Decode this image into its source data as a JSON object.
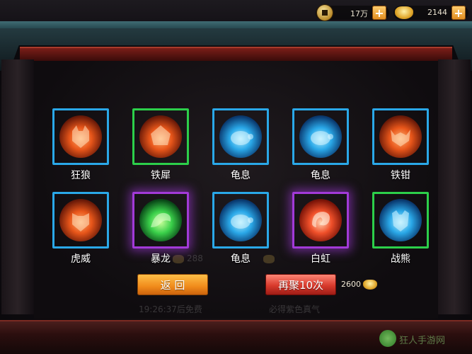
{
  "resources": {
    "coins": {
      "icon": "copper-coin-icon",
      "value": "17万"
    },
    "ingots": {
      "icon": "gold-ingot-icon",
      "value": "2144"
    }
  },
  "grid": [
    {
      "label": "狂狼",
      "rarity": "blue",
      "element": "fire",
      "icon": "wolf-icon"
    },
    {
      "label": "铁犀",
      "rarity": "green",
      "element": "fire",
      "icon": "rhino-icon"
    },
    {
      "label": "龟息",
      "rarity": "blue",
      "element": "water",
      "icon": "turtle-icon"
    },
    {
      "label": "龟息",
      "rarity": "blue",
      "element": "water",
      "icon": "turtle-icon"
    },
    {
      "label": "铁钳",
      "rarity": "blue",
      "element": "fire",
      "icon": "crab-icon"
    },
    {
      "label": "虎威",
      "rarity": "blue",
      "element": "fire",
      "icon": "tiger-icon"
    },
    {
      "label": "暴龙",
      "rarity": "purple",
      "element": "poison",
      "icon": "dragon-icon"
    },
    {
      "label": "龟息",
      "rarity": "blue",
      "element": "water",
      "icon": "turtle-icon"
    },
    {
      "label": "白虹",
      "rarity": "purple",
      "element": "red",
      "icon": "swirl-icon"
    },
    {
      "label": "战熊",
      "rarity": "green",
      "element": "water",
      "icon": "bear-icon"
    }
  ],
  "ghost": {
    "price": "288",
    "timer": "19:26:37后免费",
    "hint": "必得紫色真气"
  },
  "buttons": {
    "back": "返 回",
    "draw_ten": "再聚10次"
  },
  "cost": "2600",
  "watermark": "狂人手游网"
}
